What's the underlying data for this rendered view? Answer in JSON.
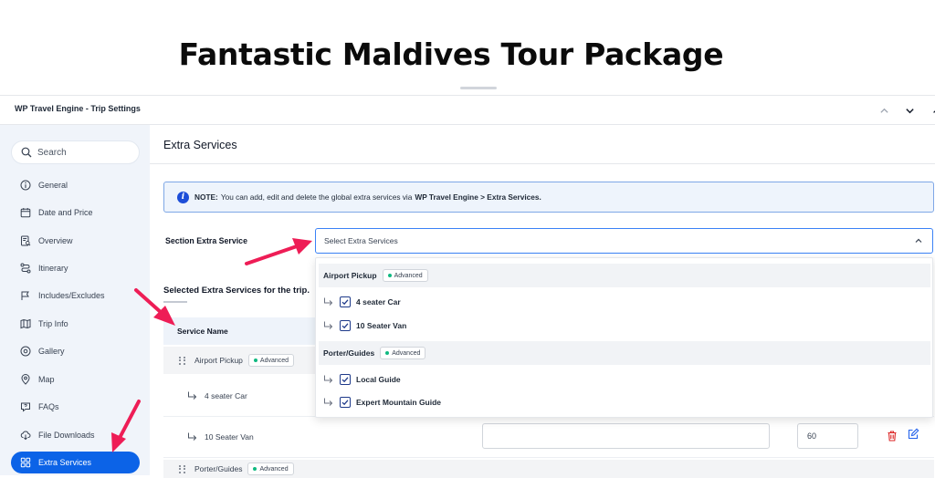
{
  "page_title": "Fantastic Maldives Tour Package",
  "panel": {
    "title": "WP Travel Engine - Trip Settings"
  },
  "sidebar": {
    "search_placeholder": "Search",
    "items": [
      {
        "label": "General",
        "icon": "info-icon"
      },
      {
        "label": "Date and Price",
        "icon": "calendar-icon"
      },
      {
        "label": "Overview",
        "icon": "overview-icon"
      },
      {
        "label": "Itinerary",
        "icon": "route-icon"
      },
      {
        "label": "Includes/Excludes",
        "icon": "flag-icon"
      },
      {
        "label": "Trip Info",
        "icon": "map-info-icon"
      },
      {
        "label": "Gallery",
        "icon": "gallery-icon"
      },
      {
        "label": "Map",
        "icon": "map-pin-icon"
      },
      {
        "label": "FAQs",
        "icon": "faq-icon"
      },
      {
        "label": "File Downloads",
        "icon": "cloud-download-icon"
      },
      {
        "label": "Extra Services",
        "icon": "grid-icon",
        "active": true
      }
    ]
  },
  "main": {
    "title": "Extra Services",
    "notice": {
      "prefix": "NOTE:",
      "text": "You can add, edit and delete the global extra services via",
      "link": "WP Travel Engine > Extra Services."
    },
    "section_label": "Section Extra Service",
    "select_placeholder": "Select Extra Services",
    "dropdown": {
      "groups": [
        {
          "name": "Airport Pickup",
          "badge": "Advanced",
          "options": [
            "4 seater Car",
            "10 Seater Van"
          ]
        },
        {
          "name": "Porter/Guides",
          "badge": "Advanced",
          "options": [
            "Local Guide",
            "Expert Mountain Guide"
          ]
        }
      ]
    },
    "selected_title": "Selected Extra Services for the trip.",
    "table": {
      "column_service_name": "Service Name",
      "rows": [
        {
          "kind": "parent",
          "name": "Airport Pickup",
          "badge": "Advanced"
        },
        {
          "kind": "child",
          "name": "4 seater Car"
        },
        {
          "kind": "child",
          "name": "10 Seater Van",
          "price": "60"
        },
        {
          "kind": "parent",
          "name": "Porter/Guides",
          "badge": "Advanced"
        }
      ]
    }
  },
  "colors": {
    "accent": "#0c63e7",
    "annotation": "#ee1d56",
    "badge_dot": "#10b981",
    "delete": "#dc2626"
  }
}
